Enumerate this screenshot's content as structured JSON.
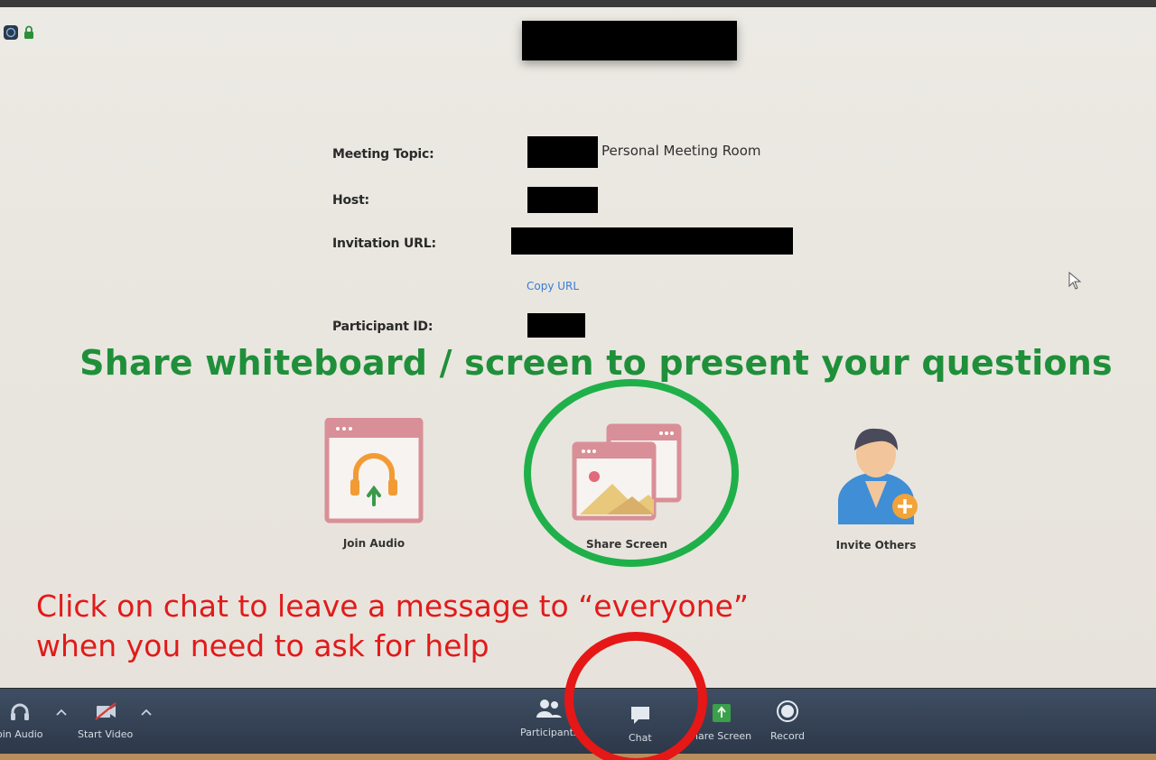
{
  "meeting": {
    "topic_label": "Meeting Topic:",
    "topic_value": "Personal Meeting Room",
    "host_label": "Host:",
    "invitation_label": "Invitation URL:",
    "copy_url": "Copy URL",
    "participant_label": "Participant ID:"
  },
  "headline": "Share whiteboard / screen to present your questions",
  "actions": {
    "join_audio": "Join Audio",
    "share_screen": "Share Screen",
    "invite_others": "Invite Others"
  },
  "annotation": {
    "line1": "Click on chat to leave a message to “everyone”",
    "line2": "when you need to ask for help"
  },
  "toolbar": {
    "join_audio": "oin Audio",
    "start_video": "Start Video",
    "participants": "Participants",
    "chat": "Chat",
    "share_screen": "hare Screen",
    "record": "Record"
  },
  "colors": {
    "headline_green": "#1f8f3a",
    "annotation_red": "#e21a1a",
    "ring_green": "#20b04a",
    "ring_red": "#e61717",
    "link_blue": "#3a7bd5",
    "toolbar_bg": "#34404f"
  },
  "icons": {
    "app": "zoom-logo-icon",
    "lock": "lock-icon",
    "join_audio": "headphones-icon",
    "share_screen": "screen-share-icon",
    "invite": "person-add-icon",
    "chat": "chat-bubble-icon",
    "record": "record-icon",
    "video": "video-off-icon",
    "participants": "participants-icon"
  }
}
